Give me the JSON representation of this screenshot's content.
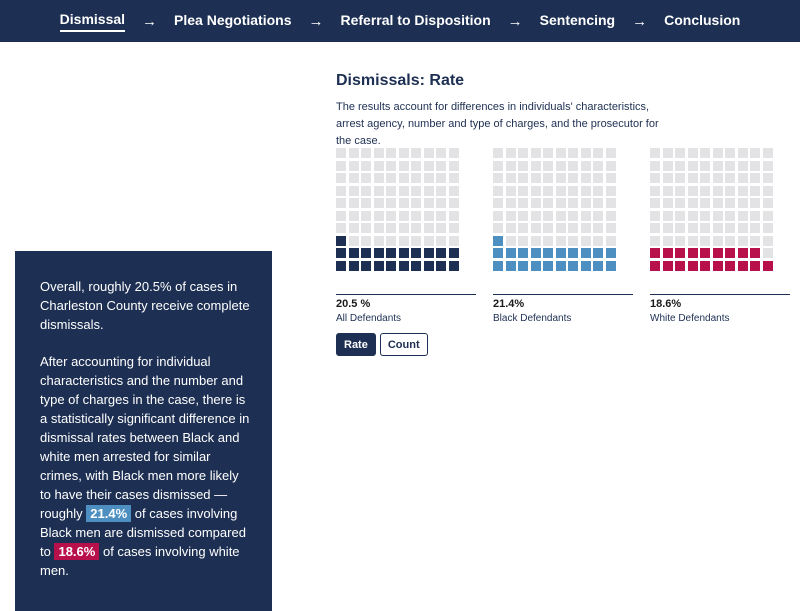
{
  "nav": {
    "items": [
      {
        "label": "Dismissal",
        "active": true
      },
      {
        "label": "Plea Negotiations",
        "active": false
      },
      {
        "label": "Referral to Disposition",
        "active": false
      },
      {
        "label": "Sentencing",
        "active": false
      },
      {
        "label": "Conclusion",
        "active": false
      }
    ],
    "arrow": "→"
  },
  "narrative": {
    "p1": "Overall, roughly 20.5% of cases in Charleston County receive complete dismissals.",
    "p2_start": "After accounting for individual characteristics and the number and type of charges in the case, there is a statistically significant difference in dismissal rates between Black and white men arrested for similar crimes, with Black men more likely to have their cases dismissed — roughly",
    "p2_hl1": "21.4%",
    "p2_mid": "of cases involving Black men are dismissed compared to",
    "p2_hl2": "18.6%",
    "p2_end": "of cases involving white men."
  },
  "panel": {
    "title": "Dismissals: Rate",
    "description": "The results account for differences in individuals' characteristics, arrest agency, number and type of charges, and the prosecutor for the case."
  },
  "chart_data": {
    "type": "waffle",
    "grid": {
      "rows": 10,
      "cols": 10
    },
    "series": [
      {
        "value_label": "20.5 %",
        "label": "All Defendants",
        "percent": 20.5,
        "color": "#1d2f52"
      },
      {
        "value_label": "21.4%",
        "label": "Black Defendants",
        "percent": 21.4,
        "color": "#4d8fc1"
      },
      {
        "value_label": "18.6%",
        "label": "White Defendants",
        "percent": 18.6,
        "color": "#b8104a"
      }
    ],
    "empty_color": "#e3e3e6"
  },
  "toggle": {
    "rate_label": "Rate",
    "count_label": "Count",
    "selected": "Rate"
  }
}
